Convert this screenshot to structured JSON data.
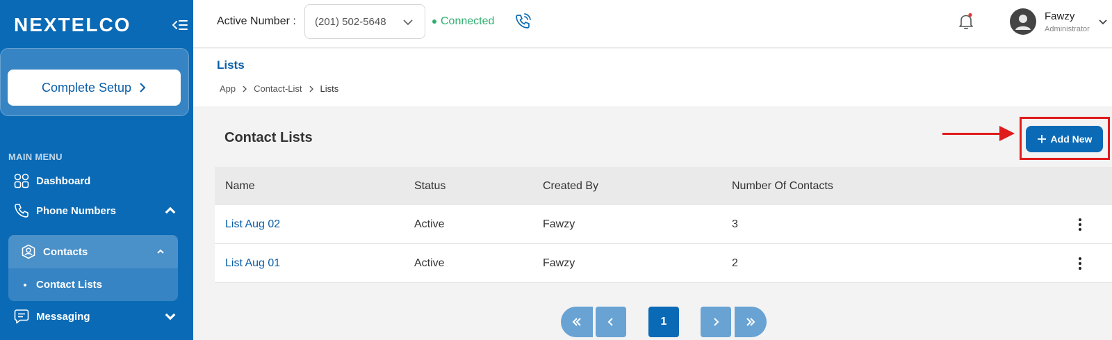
{
  "brand": {
    "name": "NEXTELCO"
  },
  "sidebar": {
    "setup_label": "Complete Setup",
    "menu_title": "MAIN MENU",
    "items": [
      {
        "label": "Dashboard",
        "icon": "grid-icon"
      },
      {
        "label": "Phone Numbers",
        "icon": "phone-icon",
        "expanded": true
      },
      {
        "label": "Contacts",
        "icon": "contact-icon",
        "expanded": true
      },
      {
        "label": "Messaging",
        "icon": "chat-icon",
        "expanded": false
      }
    ],
    "sub_items": [
      {
        "label": "Contact Lists",
        "active": true
      }
    ]
  },
  "topbar": {
    "active_label": "Active Number :",
    "number": "(201) 502-5648",
    "status": "Connected",
    "user_name": "Fawzy",
    "user_role": "Administrator"
  },
  "page": {
    "title": "Lists",
    "breadcrumb": [
      "App",
      "Contact-List",
      "Lists"
    ],
    "section_title": "Contact Lists",
    "add_label": "Add New"
  },
  "table": {
    "headers": [
      "Name",
      "Status",
      "Created By",
      "Number Of Contacts"
    ],
    "rows": [
      {
        "name": "List Aug 02",
        "status": "Active",
        "created_by": "Fawzy",
        "count": "3"
      },
      {
        "name": "List Aug 01",
        "status": "Active",
        "created_by": "Fawzy",
        "count": "2"
      }
    ]
  },
  "pagination": {
    "current": "1"
  },
  "colors": {
    "primary": "#0a6ab6",
    "success": "#2eae6e",
    "highlight": "#e01b1b"
  }
}
